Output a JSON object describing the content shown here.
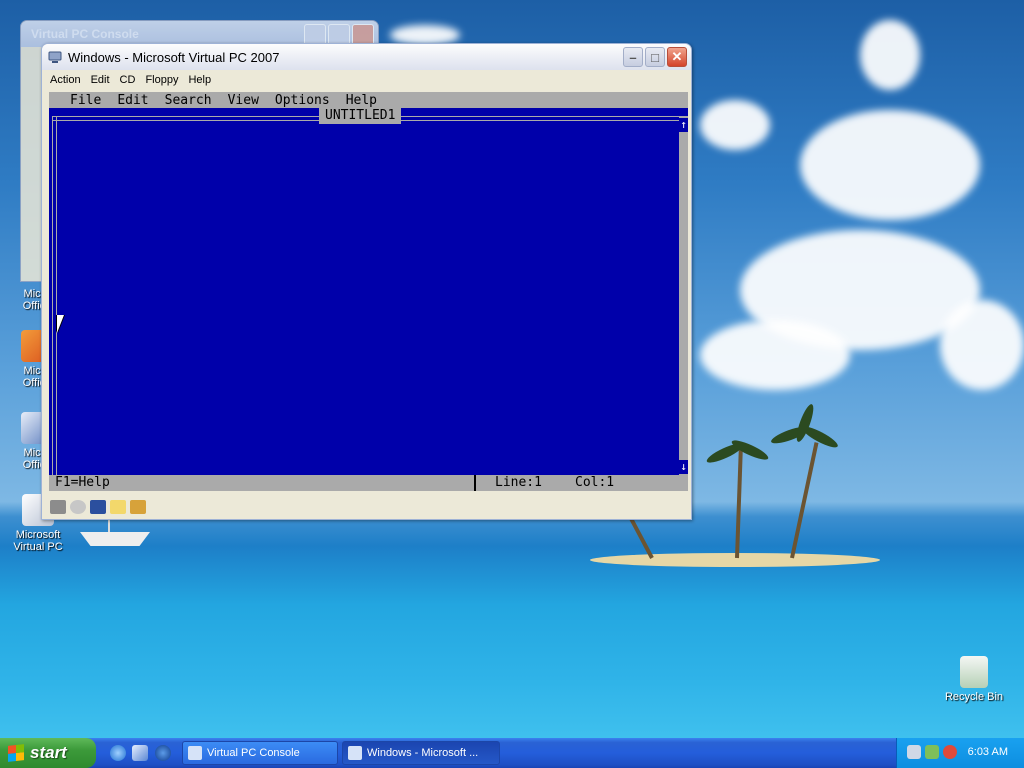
{
  "desktop": {
    "icons": [
      {
        "label": "Micro\nOffice"
      },
      {
        "label": "Micro\nOffice"
      },
      {
        "label": "Micro\nOffice"
      },
      {
        "label": "Microsoft\nVirtual PC"
      },
      {
        "label": "Recycle Bin"
      }
    ]
  },
  "console_window": {
    "title": "Virtual PC Console"
  },
  "vpc_window": {
    "title": "Windows - Microsoft Virtual PC 2007",
    "menu": [
      "Action",
      "Edit",
      "CD",
      "Floppy",
      "Help"
    ],
    "editor": {
      "menu": [
        "File",
        "Edit",
        "Search",
        "View",
        "Options",
        "Help"
      ],
      "doc_title": "UNTITLED1",
      "scroll_up": "↑",
      "scroll_down": "↓",
      "status_help": "F1=Help",
      "status_line": "Line:1",
      "status_col": "Col:1"
    },
    "status_icons": [
      "hard-disk-icon",
      "cd-icon",
      "floppy-icon",
      "shared-folder-icon",
      "network-icon"
    ]
  },
  "taskbar": {
    "start_label": "start",
    "quick_launch": [
      "ie-icon",
      "vpc-icon",
      "globe-icon"
    ],
    "tasks": [
      {
        "label": "Virtual PC Console",
        "active": false
      },
      {
        "label": "Windows - Microsoft ...",
        "active": true
      }
    ],
    "tray_icons": [
      "network-icon",
      "vpc-tray-icon",
      "shield-icon"
    ],
    "clock": "6:03 AM"
  },
  "colors": {
    "dos_background": "#0000aa",
    "dos_chrome": "#aaaaaa",
    "taskbar": "#245edb",
    "start_button": "#3c9a3a"
  }
}
